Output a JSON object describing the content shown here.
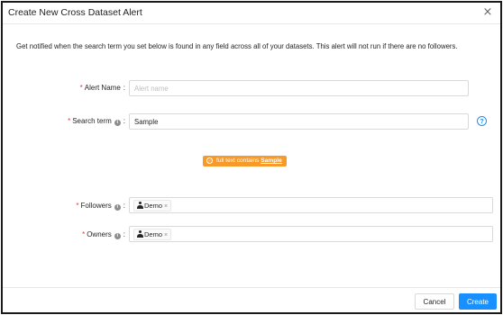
{
  "modal": {
    "title": "Create New Cross Dataset Alert",
    "close_icon": "×",
    "description": "Get notified when the search term you set below is found in any field across all of your datasets. This alert will not run if there are no followers."
  },
  "form": {
    "required_mark": "*",
    "colon": ":",
    "alert_name": {
      "label": "Alert Name",
      "value": "",
      "placeholder": "Alert name"
    },
    "search_term": {
      "label": "Search term",
      "info_icon": "i",
      "value": "Sample",
      "help_icon": "?"
    },
    "condition_tag": {
      "prefix": "full text contains",
      "term": "Sample",
      "icon": "✓",
      "color": "#f79a2a"
    },
    "followers": {
      "label": "Followers",
      "info_icon": "i",
      "chips": [
        {
          "label": "Demo",
          "remove": "×"
        }
      ]
    },
    "owners": {
      "label": "Owners",
      "info_icon": "i",
      "chips": [
        {
          "label": "Demo",
          "remove": "×"
        }
      ]
    }
  },
  "footer": {
    "cancel_label": "Cancel",
    "create_label": "Create",
    "accent_color": "#1890ff"
  }
}
